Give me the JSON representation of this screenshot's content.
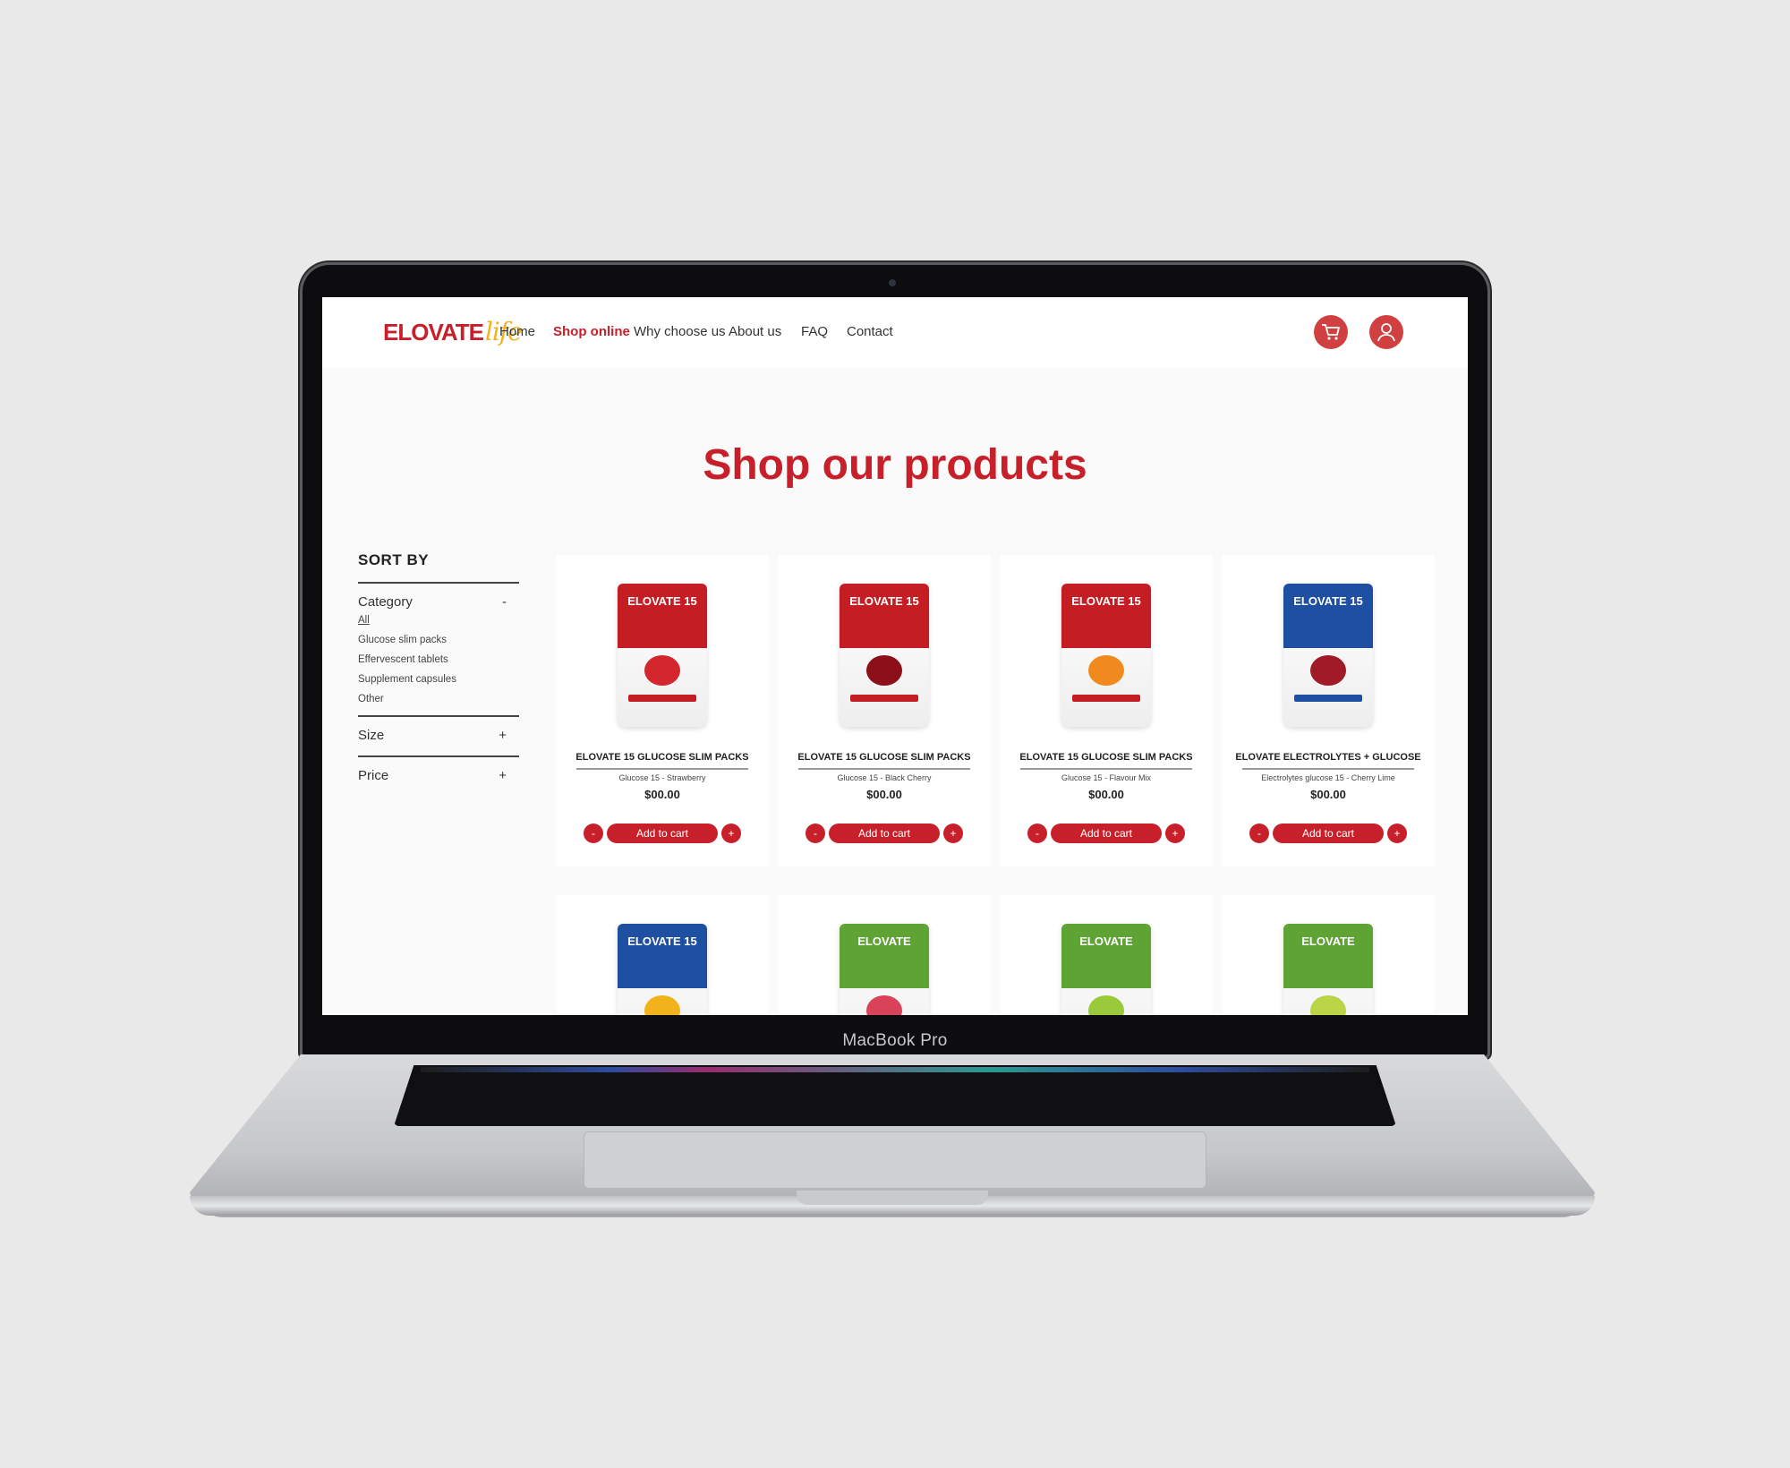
{
  "device": {
    "label": "MacBook Pro"
  },
  "brand": {
    "logo_main": "ELOVATE",
    "logo_script": "life",
    "accent": "#c8202a",
    "logo_script_color": "#f2b21b"
  },
  "nav": {
    "items": [
      {
        "label": "Home",
        "active": false
      },
      {
        "label": "Shop online",
        "active": true
      },
      {
        "label": "Why choose us",
        "active": false
      },
      {
        "label": "About us",
        "active": false
      },
      {
        "label": "FAQ",
        "active": false
      },
      {
        "label": "Contact",
        "active": false
      }
    ],
    "cart_icon": "cart-icon",
    "account_icon": "user-icon"
  },
  "page": {
    "title": "Shop our products"
  },
  "sidebar": {
    "title": "SORT BY",
    "category": {
      "label": "Category",
      "toggle": "-",
      "items": [
        "All",
        "Glucose slim packs",
        "Effervescent tablets",
        "Supplement capsules",
        "Other"
      ]
    },
    "size": {
      "label": "Size",
      "toggle": "+"
    },
    "price": {
      "label": "Price",
      "toggle": "+"
    }
  },
  "products": [
    {
      "name": "ELOVATE 15 GLUCOSE SLIM PACKS",
      "variant": "Glucose 15 - Strawberry",
      "price": "$00.00",
      "add_label": "Add to cart",
      "minus": "-",
      "plus": "+",
      "pack_brand": "ELOVATE 15",
      "pack_color": "#c41e24",
      "fruit_color": "#d3262d"
    },
    {
      "name": "ELOVATE 15 GLUCOSE SLIM PACKS",
      "variant": "Glucose 15 - Black Cherry",
      "price": "$00.00",
      "add_label": "Add to cart",
      "minus": "-",
      "plus": "+",
      "pack_brand": "ELOVATE 15",
      "pack_color": "#c41e24",
      "fruit_color": "#8c0f1a"
    },
    {
      "name": "ELOVATE 15 GLUCOSE SLIM PACKS",
      "variant": "Glucose 15 - Flavour Mix",
      "price": "$00.00",
      "add_label": "Add to cart",
      "minus": "-",
      "plus": "+",
      "pack_brand": "ELOVATE 15",
      "pack_color": "#c41e24",
      "fruit_color": "#f08a1e"
    },
    {
      "name": "ELOVATE ELECTROLYTES + GLUCOSE",
      "variant": "Electrolytes glucose 15 - Cherry Lime",
      "price": "$00.00",
      "add_label": "Add to cart",
      "minus": "-",
      "plus": "+",
      "pack_brand": "ELOVATE 15",
      "pack_color": "#1f4fa0",
      "fruit_color": "#a01a28"
    },
    {
      "pack_brand": "ELOVATE 15",
      "pack_color": "#1f4fa0",
      "fruit_color": "#f2b21b"
    },
    {
      "pack_brand": "ELOVATE",
      "pack_color": "#5fa334",
      "fruit_color": "#d9435a"
    },
    {
      "pack_brand": "ELOVATE",
      "pack_color": "#5fa334",
      "fruit_color": "#9bc93c"
    },
    {
      "pack_brand": "ELOVATE",
      "pack_color": "#5fa334",
      "fruit_color": "#b9d447"
    }
  ]
}
